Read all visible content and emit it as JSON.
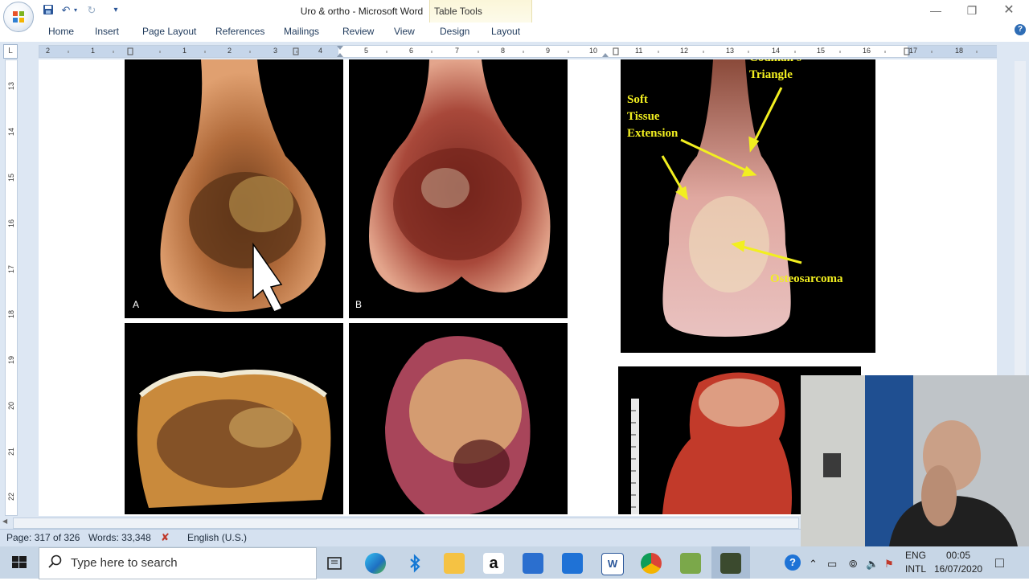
{
  "window": {
    "title": "Uro & ortho  -  Microsoft Word",
    "context_tab": "Table Tools"
  },
  "ribbon": {
    "tabs": [
      "Home",
      "Insert",
      "Page Layout",
      "References",
      "Mailings",
      "Review",
      "View",
      "Design",
      "Layout"
    ]
  },
  "ruler": {
    "h_numbers": [
      "2",
      "1",
      "1",
      "2",
      "3",
      "4",
      "5",
      "6",
      "7",
      "8",
      "9",
      "10",
      "11",
      "12",
      "13",
      "14",
      "15",
      "16",
      "17",
      "18"
    ],
    "v_numbers": [
      "13",
      "14",
      "15",
      "16",
      "17",
      "18",
      "19",
      "20",
      "21",
      "22"
    ]
  },
  "document": {
    "figures": [
      {
        "label": "A"
      },
      {
        "label": "B"
      }
    ],
    "annotated_figure": {
      "triangle_label_top": "Codman's",
      "triangle_label": "Triangle",
      "soft_tissue_label": "Soft\nTissue\nExtension",
      "tumor_label": "Osteosarcoma"
    }
  },
  "statusbar": {
    "page": "Page: 317 of 326",
    "words": "Words: 33,348",
    "language": "English (U.S.)"
  },
  "taskbar": {
    "search_placeholder": "Type here to search",
    "lang_top": "ENG",
    "lang_bottom": "INTL",
    "time": "00:05",
    "date": "16/07/2020"
  },
  "colors": {
    "ribbon_text": "#1e395b",
    "annotation_yellow": "#f2ef20",
    "statusbar_bg": "#d5e1f0",
    "taskbar_bg": "#c7d6e6"
  }
}
